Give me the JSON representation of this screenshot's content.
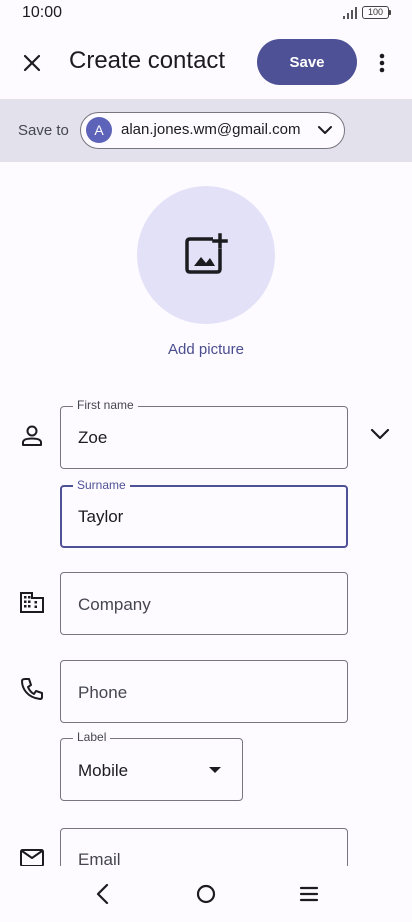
{
  "status": {
    "time": "10:00",
    "battery": "100"
  },
  "appbar": {
    "title": "Create contact",
    "save_label": "Save"
  },
  "save_to": {
    "label": "Save to",
    "account_initial": "A",
    "account_email": "alan.jones.wm@gmail.com"
  },
  "picture": {
    "label": "Add picture"
  },
  "fields": {
    "first_name": {
      "label": "First name",
      "value": "Zoe"
    },
    "surname": {
      "label": "Surname",
      "value": "Taylor"
    },
    "company": {
      "placeholder": "Company"
    },
    "phone": {
      "placeholder": "Phone"
    },
    "phone_label": {
      "label": "Label",
      "value": "Mobile"
    },
    "email": {
      "placeholder": "Email"
    }
  },
  "icons": {
    "close": "close-icon",
    "more": "more-vert-icon",
    "chevron": "chevron-down-icon",
    "add_photo": "add-photo-icon",
    "person": "person-icon",
    "company": "company-icon",
    "phone": "phone-icon",
    "email": "email-icon"
  },
  "colors": {
    "accent": "#4f5196",
    "save_to_bar": "#e3e2ec",
    "picture_bg": "#e3e1f7",
    "background": "#fdfbff"
  }
}
